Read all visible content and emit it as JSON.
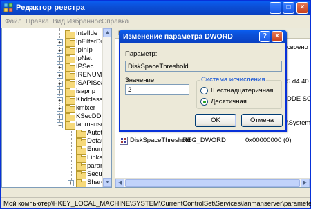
{
  "window": {
    "title": "Редактор реестра"
  },
  "menu": [
    "Файл",
    "Правка",
    "Вид",
    "Избранное",
    "Справка"
  ],
  "tree": {
    "items": [
      {
        "label": "IntelIde",
        "expander": ""
      },
      {
        "label": "IpFilterDriver",
        "expander": "+"
      },
      {
        "label": "IpInIp",
        "expander": "+"
      },
      {
        "label": "IpNat",
        "expander": "+"
      },
      {
        "label": "IPSec",
        "expander": "+"
      },
      {
        "label": "IRENUM",
        "expander": "+"
      },
      {
        "label": "ISAPISearch",
        "expander": "+"
      },
      {
        "label": "isapnp",
        "expander": "+"
      },
      {
        "label": "Kbdclass",
        "expander": "+"
      },
      {
        "label": "kmixer",
        "expander": "+"
      },
      {
        "label": "KSecDD",
        "expander": "+"
      },
      {
        "label": "lanmanserver",
        "expander": "−"
      }
    ],
    "children": [
      {
        "label": "Autotuned",
        "expander": ""
      },
      {
        "label": "DefaultS",
        "expander": ""
      },
      {
        "label": "Enum",
        "expander": ""
      },
      {
        "label": "Linkage",
        "expander": ""
      },
      {
        "label": "parameters",
        "expander": ""
      },
      {
        "label": "Security",
        "expander": ""
      },
      {
        "label": "Shares",
        "expander": "+"
      }
    ]
  },
  "list": {
    "header_frag": "И",
    "fragments": [
      "своено",
      "5 d4 40 b",
      "DDE SQL|",
      "\\System3"
    ],
    "row": {
      "name": "DiskSpaceThreshold",
      "type": "REG_DWORD",
      "data": "0x00000000 (0)"
    }
  },
  "status": "Мой компьютер\\HKEY_LOCAL_MACHINE\\SYSTEM\\CurrentControlSet\\Services\\lanmanserver\\parameters",
  "dialog": {
    "title": "Изменение параметра DWORD",
    "param_label": "Параметр:",
    "param_value": "DiskSpaceThreshold",
    "value_label": "Значение:",
    "value": "2",
    "base_label": "Система исчисления",
    "hex_label": "Шестнадцатеричная",
    "dec_label": "Десятичная",
    "selected_base": "dec",
    "ok": "OK",
    "cancel": "Отмена"
  }
}
